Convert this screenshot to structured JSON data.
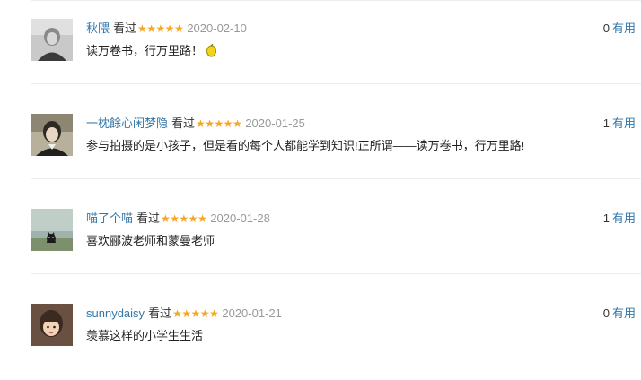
{
  "reviews": [
    {
      "user": "秋隈",
      "status": "看过",
      "stars": "★★★★★",
      "rating": 5,
      "date": "2020-02-10",
      "content": "读万卷书，行万里路！",
      "emoji": "lemon-icon",
      "vote_count": "0",
      "vote_label": "有用"
    },
    {
      "user": "一枕餘心闲梦隐",
      "status": "看过",
      "stars": "★★★★★",
      "rating": 5,
      "date": "2020-01-25",
      "content": "参与拍摄的是小孩子，但是看的每个人都能学到知识!正所谓——读万卷书，行万里路!",
      "vote_count": "1",
      "vote_label": "有用"
    },
    {
      "user": "喵了个喵",
      "status": "看过",
      "stars": "★★★★★",
      "rating": 5,
      "date": "2020-01-28",
      "content": "喜欢郦波老师和蒙曼老师",
      "vote_count": "1",
      "vote_label": "有用"
    },
    {
      "user": "sunnydaisy",
      "status": "看过",
      "stars": "★★★★★",
      "rating": 5,
      "date": "2020-01-21",
      "content": "羡慕这样的小学生生活",
      "vote_count": "0",
      "vote_label": "有用"
    }
  ],
  "colors": {
    "link": "#3377aa",
    "star": "#f5a623",
    "date": "#999999",
    "divider": "#ececec"
  }
}
